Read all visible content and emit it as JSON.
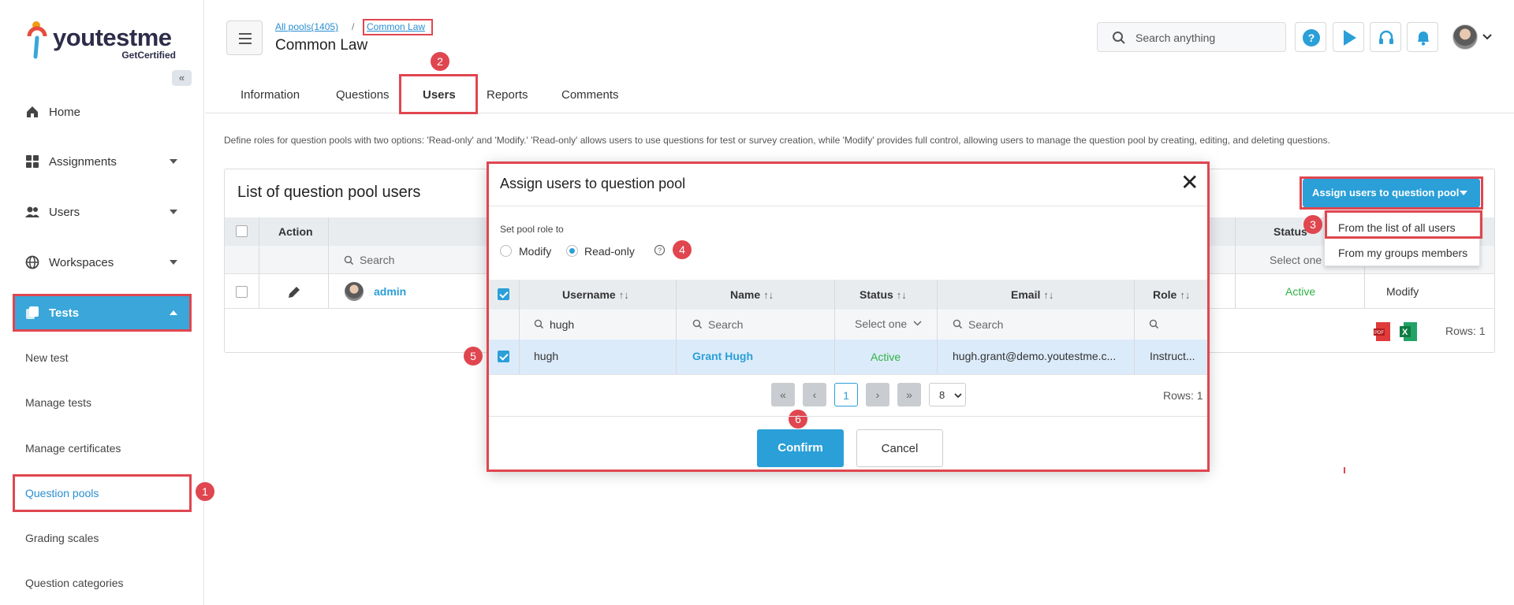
{
  "brand": {
    "name": "youtestme",
    "sub": "GetCertified"
  },
  "colors": {
    "accent": "#2a9fd8",
    "annotation": "#e0464f",
    "active_status": "#2fb344"
  },
  "sidebar": {
    "items": [
      {
        "label": "Home",
        "icon": "home-icon"
      },
      {
        "label": "Assignments",
        "icon": "assignments-icon"
      },
      {
        "label": "Users",
        "icon": "users-icon"
      },
      {
        "label": "Workspaces",
        "icon": "globe-icon"
      },
      {
        "label": "Tests",
        "icon": "tests-icon"
      }
    ],
    "sub_items": [
      "New test",
      "Manage tests",
      "Manage certificates",
      "Question pools",
      "Grading scales",
      "Question categories"
    ]
  },
  "header": {
    "breadcrumb_root": "All pools(1405)",
    "breadcrumb_sep": "/",
    "breadcrumb_current": "Common Law",
    "title": "Common Law",
    "search_placeholder": "Search anything"
  },
  "tabs": [
    "Information",
    "Questions",
    "Users",
    "Reports",
    "Comments"
  ],
  "description": "Define roles for question pools with two options: 'Read-only' and 'Modify.' 'Read-only' allows users to use questions for test or survey creation, while 'Modify' provides full control, allowing users to manage the question pool by creating, editing, and deleting questions.",
  "list": {
    "title": "List of question pool users",
    "assign_button": "Assign users to question pool",
    "dropdown": [
      "From the list of all users",
      "From my groups members"
    ],
    "columns": {
      "action": "Action",
      "status": "Status"
    },
    "filter_search": "Search",
    "filter_select": "Select one",
    "row": {
      "user": "admin",
      "status": "Active",
      "role": "Modify"
    },
    "rows_label": "Rows: 1"
  },
  "modal": {
    "title": "Assign users to question pool",
    "role_label": "Set pool role to",
    "role_modify": "Modify",
    "role_readonly": "Read-only",
    "columns": [
      "Username",
      "Name",
      "Status",
      "Email",
      "Role"
    ],
    "sort_glyph": "↑↓",
    "filters": {
      "username": "hugh",
      "name": "Search",
      "status": "Select one",
      "email": "Search"
    },
    "row": {
      "username": "hugh",
      "name": "Grant Hugh",
      "status": "Active",
      "email": "hugh.grant@demo.youtestme.c...",
      "role": "Instruct..."
    },
    "pagination": {
      "page": "1",
      "per_page": "8",
      "rows": "Rows: 1"
    },
    "confirm": "Confirm",
    "cancel": "Cancel"
  },
  "annotations": [
    "1",
    "2",
    "3",
    "4",
    "5",
    "6"
  ]
}
